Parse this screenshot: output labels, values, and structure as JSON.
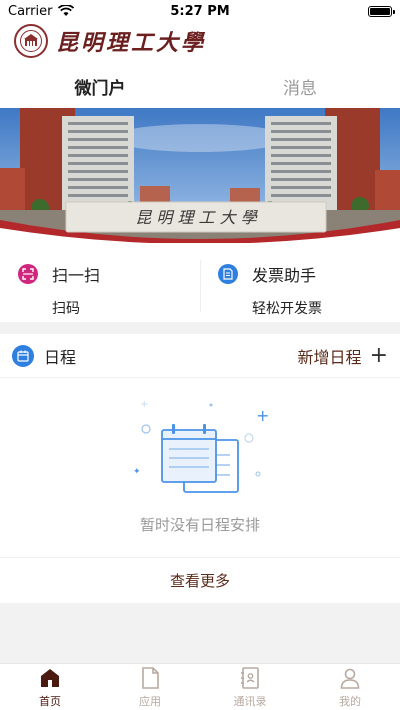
{
  "status": {
    "carrier": "Carrier",
    "time": "5:27 PM"
  },
  "header": {
    "school_name": "昆明理工大學"
  },
  "tabs": [
    {
      "label": "微门户",
      "active": true
    },
    {
      "label": "消息",
      "active": false
    }
  ],
  "banner": {
    "gate_text": "昆 明 理 工 大 學"
  },
  "quick_actions": [
    {
      "title": "扫一扫",
      "subtitle": "扫码",
      "icon": "scan-icon",
      "color": "#d0267e"
    },
    {
      "title": "发票助手",
      "subtitle": "轻松开发票",
      "icon": "invoice-icon",
      "color": "#2f7fe0"
    }
  ],
  "schedule": {
    "title": "日程",
    "add_label": "新增日程",
    "empty_text": "暂时没有日程安排",
    "more_label": "查看更多"
  },
  "tabbar": [
    {
      "label": "首页",
      "icon": "home-icon",
      "active": true
    },
    {
      "label": "应用",
      "icon": "apps-icon",
      "active": false
    },
    {
      "label": "通讯录",
      "icon": "contacts-icon",
      "active": false
    },
    {
      "label": "我的",
      "icon": "profile-icon",
      "active": false
    }
  ],
  "colors": {
    "brand": "#5a1414",
    "accent_blue": "#2f7fe0",
    "accent_pink": "#d0267e"
  }
}
